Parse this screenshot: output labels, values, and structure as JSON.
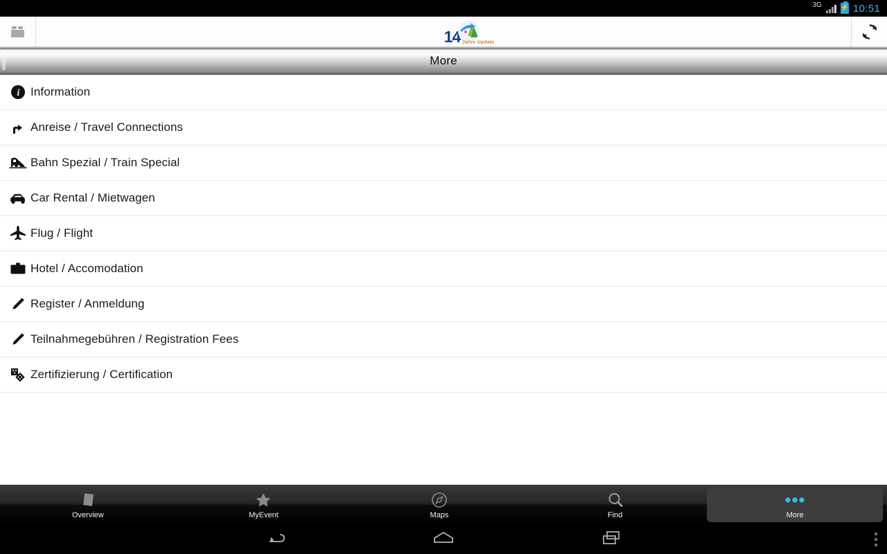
{
  "status_bar": {
    "network_label": "3G",
    "battery_icon": "battery-charging-icon",
    "signal_icon": "signal-bars-icon",
    "time": "10:51"
  },
  "toolbar": {
    "left_icon": "briefcase-folder-icon",
    "right_icon": "refresh-sync-icon",
    "logo": {
      "number": "14",
      "tagline": "Jahre Update",
      "badge_icon": "event-logo-badge-icon"
    }
  },
  "title_bar": {
    "title": "More"
  },
  "list": {
    "items": [
      {
        "icon": "info-circle-icon",
        "label": "Information"
      },
      {
        "icon": "turn-arrow-icon",
        "label": "Anreise / Travel Connections"
      },
      {
        "icon": "train-icon",
        "label": "Bahn Spezial / Train Special"
      },
      {
        "icon": "car-icon",
        "label": "Car Rental / Mietwagen"
      },
      {
        "icon": "airplane-icon",
        "label": "Flug / Flight"
      },
      {
        "icon": "briefcase-icon",
        "label": "Hotel / Accomodation"
      },
      {
        "icon": "pencil-icon",
        "label": "Register / Anmeldung"
      },
      {
        "icon": "pencil-icon",
        "label": "Teilnahmegebühren / Registration Fees"
      },
      {
        "icon": "dice-certificate-icon",
        "label": "Zertifizierung / Certification"
      }
    ]
  },
  "tab_bar": {
    "selected_index": 4,
    "tabs": [
      {
        "icon": "page-icon",
        "label": "Overview"
      },
      {
        "icon": "star-icon",
        "label": "MyEvent"
      },
      {
        "icon": "compass-icon",
        "label": "Maps"
      },
      {
        "icon": "magnifier-icon",
        "label": "Find"
      },
      {
        "icon": "three-dots-icon",
        "label": "More"
      }
    ]
  },
  "nav_bar": {
    "back_icon": "back-arrow-icon",
    "home_icon": "home-icon",
    "recents_icon": "recents-icon",
    "overflow_icon": "overflow-menu-icon"
  },
  "colors": {
    "accent": "#3fb6e5",
    "logo_blue": "#0f3f8c",
    "logo_orange": "#e87f22",
    "tab_dot": "#35bdf0"
  }
}
